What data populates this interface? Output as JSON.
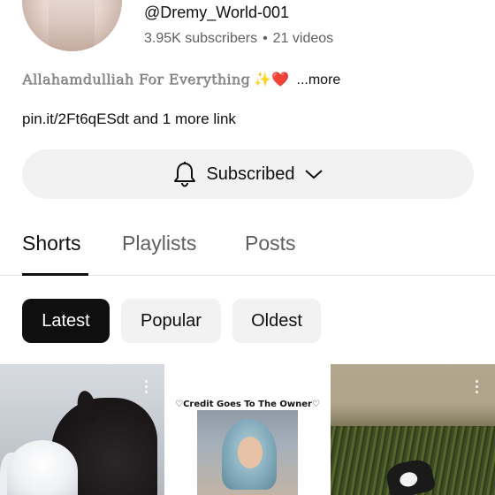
{
  "channel": {
    "handle": "@Dremy_World-001",
    "subscribers": "3.95K subscribers",
    "separator": "•",
    "videos": "21 videos",
    "bio_text": "Allahamdulliah For Everything",
    "bio_sparkle": "✨",
    "bio_heart": "❤️",
    "bio_more": "...more",
    "link_text": "pin.it/2Ft6qESdt and 1 more link"
  },
  "subscribe": {
    "label": "Subscribed",
    "bell_icon": "bell-icon",
    "chevron_icon": "chevron-down-icon"
  },
  "tabs": [
    {
      "label": "Shorts",
      "active": true
    },
    {
      "label": "Playlists",
      "active": false
    },
    {
      "label": "Posts",
      "active": false
    }
  ],
  "chips": [
    {
      "label": "Latest",
      "active": true
    },
    {
      "label": "Popular",
      "active": false
    },
    {
      "label": "Oldest",
      "active": false
    }
  ],
  "shorts": [
    {
      "caption": ""
    },
    {
      "caption": "♡Credit Goes To The Owner♡"
    },
    {
      "caption": ""
    }
  ],
  "colors": {
    "accent": "#0f0f0f",
    "chip_bg": "#f2f2f2",
    "secondary_text": "#606060"
  }
}
